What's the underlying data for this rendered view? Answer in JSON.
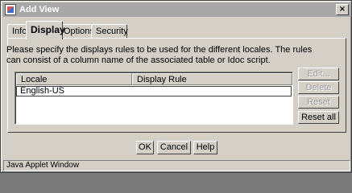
{
  "window": {
    "title": "Add View",
    "close_glyph": "×"
  },
  "tabs": [
    {
      "label": "Info",
      "active": false
    },
    {
      "label": "Display",
      "active": true
    },
    {
      "label": "Options",
      "active": false
    },
    {
      "label": "Security",
      "active": false
    }
  ],
  "panel": {
    "description": "Please specify the displays rules to be used for the different locales. The rules can consist of a column name of the associated table or Idoc script.",
    "table": {
      "columns": [
        "Locale",
        "Display Rule"
      ],
      "rows": [
        {
          "locale": "English-US",
          "display_rule": ""
        }
      ]
    },
    "side_buttons": [
      {
        "label": "Edit...",
        "enabled": false
      },
      {
        "label": "Delete",
        "enabled": false
      },
      {
        "label": "Reset",
        "enabled": false
      },
      {
        "label": "Reset all",
        "enabled": true
      }
    ]
  },
  "footer": {
    "ok_label": "OK",
    "cancel_label": "Cancel",
    "help_label": "Help"
  },
  "status": "Java Applet Window"
}
